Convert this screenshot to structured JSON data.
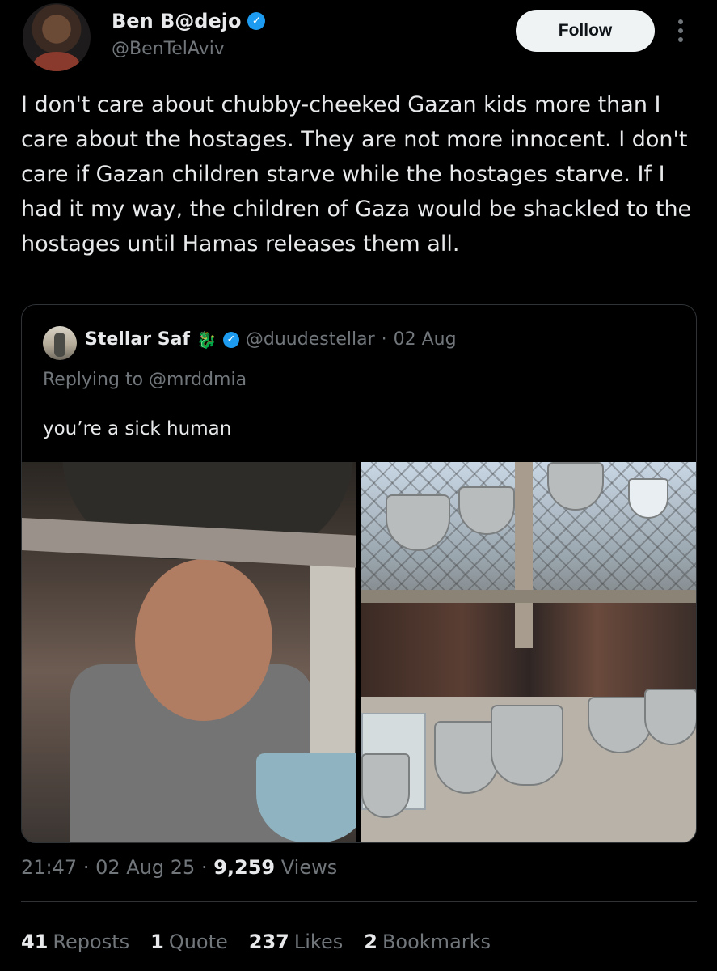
{
  "author": {
    "display_name": "Ben B@dejo",
    "handle": "@BenTelAviv",
    "verified_mark": "✓"
  },
  "follow_button": {
    "label": "Follow"
  },
  "icons": {
    "more": "more-icon",
    "verified": "verified-badge-icon",
    "snake": "snake-emoji"
  },
  "tweet": {
    "text": "I don't care about chubby-cheeked Gazan kids more than I care about the hostages. They are not more innocent. I don't care if Gazan children starve while the hostages starve. If I had it my way, the children of Gaza would be shackled to the hostages until Hamas releases them all."
  },
  "quoted_tweet": {
    "display_name": "Stellar Saf",
    "emoji": "🐉",
    "verified_mark": "✓",
    "handle": "@duudestellar",
    "separator": "·",
    "date": "02 Aug",
    "replying_to": "Replying to @mrddmia",
    "text": "you’re a sick human"
  },
  "meta": {
    "time": "21:47",
    "sep1": "·",
    "date": "02 Aug 25",
    "sep2": "·",
    "views_count": "9,259",
    "views_label": "Views"
  },
  "stats": {
    "reposts_count": "41",
    "reposts_label": "Reposts",
    "quotes_count": "1",
    "quotes_label": "Quote",
    "likes_count": "237",
    "likes_label": "Likes",
    "bookmarks_count": "2",
    "bookmarks_label": "Bookmarks"
  },
  "colors": {
    "background": "#000000",
    "text_primary": "#e7e9ea",
    "text_secondary": "#71767b",
    "verified_blue": "#1d9bf0",
    "follow_bg": "#eff3f4",
    "border": "#2f3336"
  }
}
